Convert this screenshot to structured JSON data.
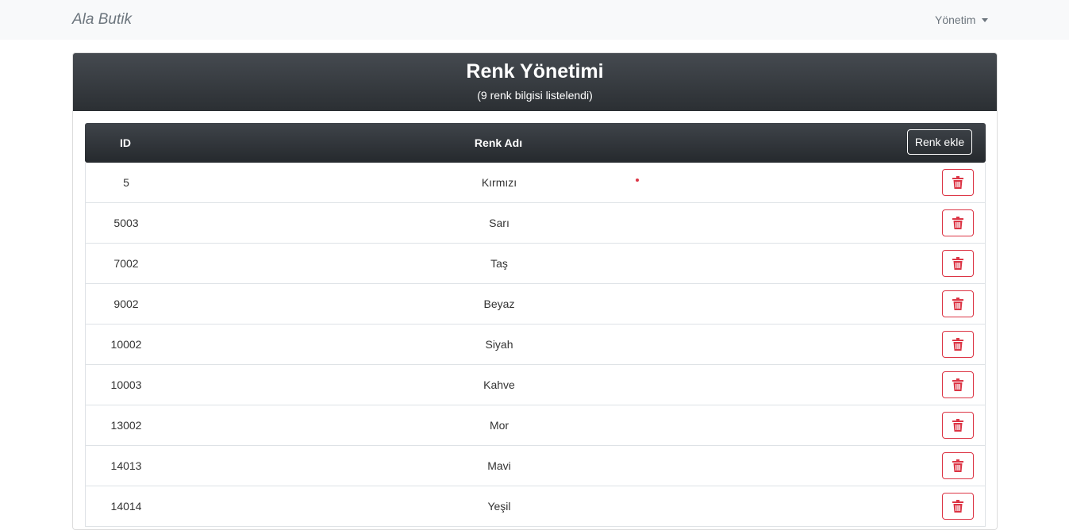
{
  "navbar": {
    "brand": "Ala Butik",
    "menu_label": "Yönetim"
  },
  "card": {
    "title": "Renk Yönetimi",
    "subtitle": "(9 renk bilgisi listelendi)"
  },
  "table": {
    "headers": {
      "id": "ID",
      "name": "Renk Adı"
    },
    "add_button": "Renk ekle",
    "rows": [
      {
        "id": "5",
        "name": "Kırmızı"
      },
      {
        "id": "5003",
        "name": "Sarı"
      },
      {
        "id": "7002",
        "name": "Taş"
      },
      {
        "id": "9002",
        "name": "Beyaz"
      },
      {
        "id": "10002",
        "name": "Siyah"
      },
      {
        "id": "10003",
        "name": "Kahve"
      },
      {
        "id": "13002",
        "name": "Mor"
      },
      {
        "id": "14013",
        "name": "Mavi"
      },
      {
        "id": "14014",
        "name": "Yeşil"
      }
    ]
  },
  "colors": {
    "danger": "#dc3545",
    "header_dark": "#343a40"
  },
  "icons": {
    "delete": "trash-icon",
    "menu": "caret-down-icon"
  }
}
